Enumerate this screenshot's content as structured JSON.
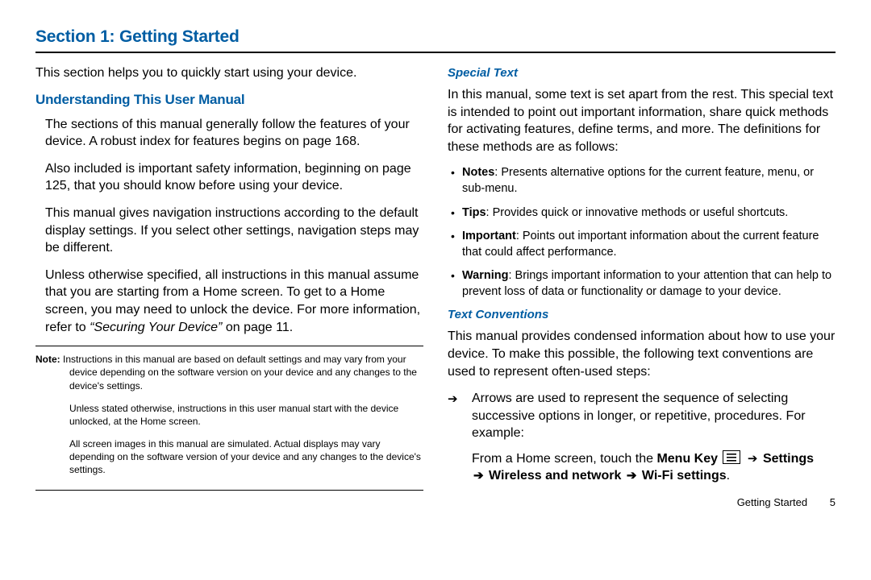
{
  "section_title": "Section 1: Getting Started",
  "left": {
    "intro": "This section helps you to quickly start using your device.",
    "h_understanding": "Understanding This User Manual",
    "p1": "The sections of this manual generally follow the features of your device. A robust index for features begins on page 168.",
    "p2": "Also included is important safety information, beginning on page 125, that you should know before using your device.",
    "p3": "This manual gives navigation instructions according to the default display settings. If you select other settings, navigation steps may be different.",
    "p4_a": "Unless otherwise specified, all instructions in this manual assume that you are starting from a Home screen. To get to a Home screen, you may need to unlock the device. For more information, refer to ",
    "p4_ref": "“Securing Your Device”",
    "p4_b": "  on page 11.",
    "note_label": "Note:",
    "note1": "Instructions in this manual are based on default settings and may vary from your device depending on the software version on your device and any changes to the device's settings.",
    "note2": "Unless stated otherwise, instructions in this user manual start with the device unlocked, at the Home screen.",
    "note3": "All screen images in this manual are simulated. Actual displays may vary depending on the software version of your device and any changes to the device's settings."
  },
  "right": {
    "h_special": "Special Text",
    "special_intro": "In this manual, some text is set apart from the rest. This special text is intended to point out important information, share quick methods for activating features, define terms, and more. The definitions for these methods are as follows:",
    "bullets": [
      {
        "label": "Notes",
        "text": ": Presents alternative options for the current feature, menu, or sub-menu."
      },
      {
        "label": "Tips",
        "text": ": Provides quick or innovative methods or useful shortcuts."
      },
      {
        "label": "Important",
        "text": ": Points out important information about the current feature that could affect performance."
      },
      {
        "label": "Warning",
        "text": ": Brings important information to your attention that can help to prevent loss of data or functionality or damage to your device."
      }
    ],
    "h_conv": "Text Conventions",
    "conv_intro": "This manual provides condensed information about how to use your device. To make this possible, the following text conventions are used to represent often-used steps:",
    "arrow_item": "Arrows are used to represent the sequence of selecting successive options in longer, or repetitive, procedures. For example:",
    "example_a": "From a Home screen, touch the ",
    "example_menu_key": "Menu Key",
    "example_settings": "Settings",
    "example_wireless": "Wireless and network",
    "example_wifi": "Wi-Fi settings",
    "arrow_char": "➔"
  },
  "footer": {
    "label": "Getting Started",
    "page": "5"
  }
}
